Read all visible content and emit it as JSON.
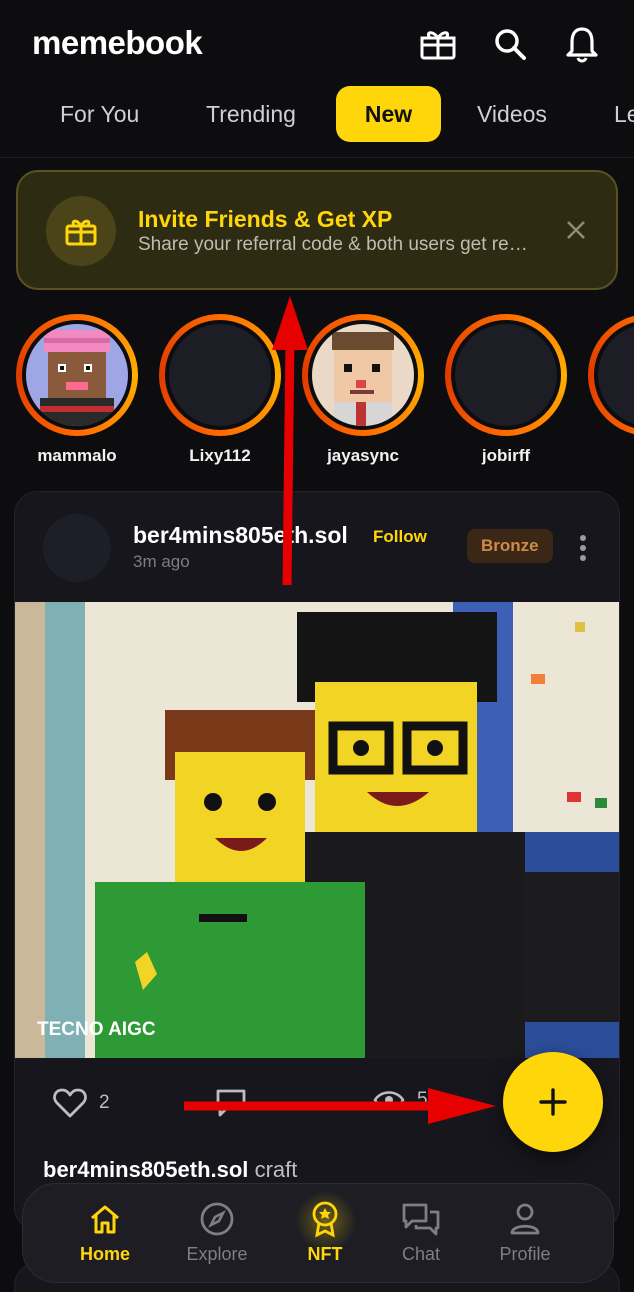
{
  "app": {
    "title": "memebook"
  },
  "header": {
    "icons": [
      "gift-icon",
      "search-icon",
      "bell-icon"
    ],
    "tabs": [
      {
        "label": "For You",
        "active": false
      },
      {
        "label": "Trending",
        "active": false
      },
      {
        "label": "New",
        "active": true
      },
      {
        "label": "Videos",
        "active": false
      },
      {
        "label": "Le",
        "active": false
      }
    ]
  },
  "banner": {
    "title": "Invite Friends & Get XP",
    "subtitle": "Share your referral code & both users get rewarded",
    "icon": "gift-icon",
    "close_icon": "close-icon"
  },
  "stories": [
    {
      "name": "mammalo",
      "has_avatar": true
    },
    {
      "name": "Lixy112",
      "has_avatar": false
    },
    {
      "name": "jayasync",
      "has_avatar": true
    },
    {
      "name": "jobirff",
      "has_avatar": false
    }
  ],
  "post": {
    "username": "ber4mins805eth.sol",
    "follow_label": "Follow",
    "time": "3m ago",
    "tier": "Bronze",
    "watermark": "TECNO AIGC",
    "likes": "2",
    "views": "5",
    "caption_user": "ber4mins805eth.sol",
    "caption_text": "craft"
  },
  "fab": {
    "icon": "plus-icon"
  },
  "nav": [
    {
      "label": "Home",
      "icon": "home-icon",
      "active": true
    },
    {
      "label": "Explore",
      "icon": "compass-icon",
      "active": false
    },
    {
      "label": "NFT",
      "icon": "medal-icon",
      "active": true
    },
    {
      "label": "Chat",
      "icon": "chat-icon",
      "active": false
    },
    {
      "label": "Profile",
      "icon": "user-icon",
      "active": false
    }
  ],
  "colors": {
    "accent": "#ffd60a",
    "background": "#0d0d10",
    "card": "#16161c",
    "tier": "#d08a47",
    "annotation": "#e60000"
  }
}
